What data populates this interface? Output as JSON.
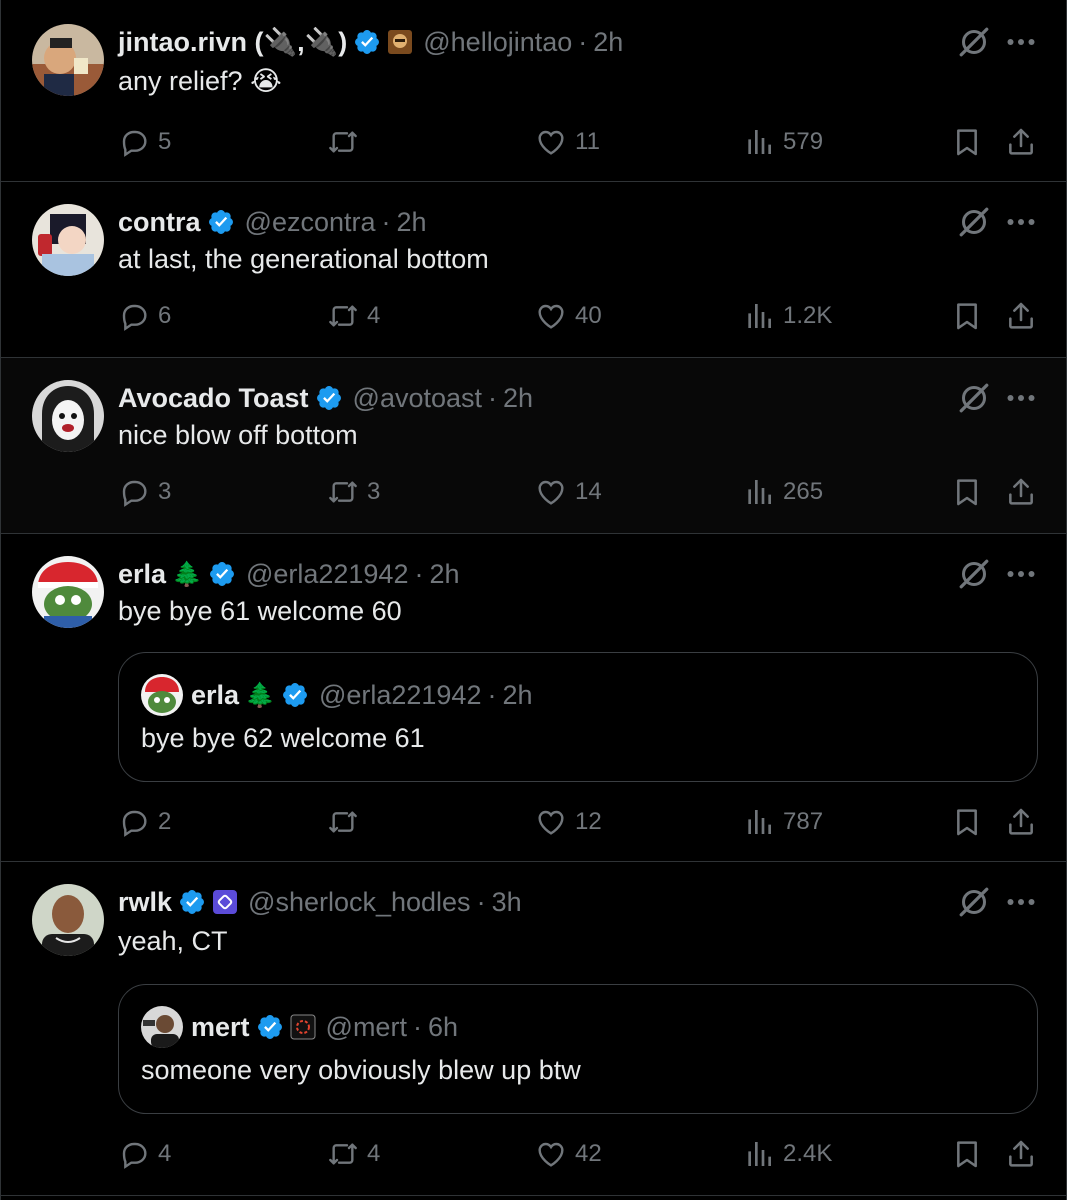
{
  "tweets": [
    {
      "name": "jintao.rivn (🔌,🔌)",
      "handle": "@hellojintao",
      "time": "2h",
      "text": "any relief? 😭",
      "replies": "5",
      "reposts": "",
      "likes": "11",
      "views": "579"
    },
    {
      "name": "contra",
      "handle": "@ezcontra",
      "time": "2h",
      "text": "at last, the generational bottom",
      "replies": "6",
      "reposts": "4",
      "likes": "40",
      "views": "1.2K"
    },
    {
      "name": "Avocado Toast",
      "handle": "@avotoast",
      "time": "2h",
      "text": "nice blow off bottom",
      "replies": "3",
      "reposts": "3",
      "likes": "14",
      "views": "265"
    },
    {
      "name": "erla",
      "name_emoji": "🌲",
      "handle": "@erla221942",
      "time": "2h",
      "text": "bye bye 61 welcome 60",
      "replies": "2",
      "reposts": "",
      "likes": "12",
      "views": "787",
      "quote": {
        "name": "erla",
        "name_emoji": "🌲",
        "handle": "@erla221942",
        "time": "2h",
        "text": "bye bye 62 welcome 61"
      }
    },
    {
      "name": "rwlk",
      "handle": "@sherlock_hodles",
      "time": "3h",
      "text": "yeah, CT",
      "replies": "4",
      "reposts": "4",
      "likes": "42",
      "views": "2.4K",
      "quote": {
        "name": "mert",
        "handle": "@mert",
        "time": "6h",
        "text": "someone very obviously blew up btw"
      }
    }
  ],
  "separator": "·",
  "colors": {
    "background": "#000000",
    "text": "#e7e9ea",
    "muted": "#71767b",
    "verified": "#1d9bf0",
    "border": "#2f3336"
  }
}
